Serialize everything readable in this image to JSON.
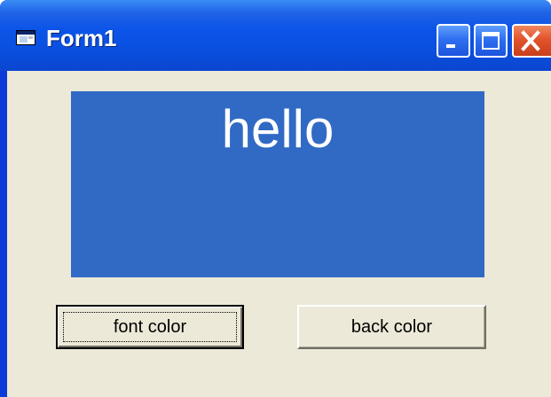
{
  "window": {
    "title": "Form1",
    "icon": "form-window-icon",
    "titlebar_color": "#0a4fe0",
    "client_color": "#ece9d8"
  },
  "controls": {
    "minimize_icon": "minimize-icon",
    "maximize_icon": "maximize-icon",
    "close_icon": "close-icon"
  },
  "label": {
    "text": "hello",
    "back_color": "#316ac5",
    "font_color": "#ffffff"
  },
  "buttons": {
    "font_color": "font color",
    "back_color": "back color"
  }
}
